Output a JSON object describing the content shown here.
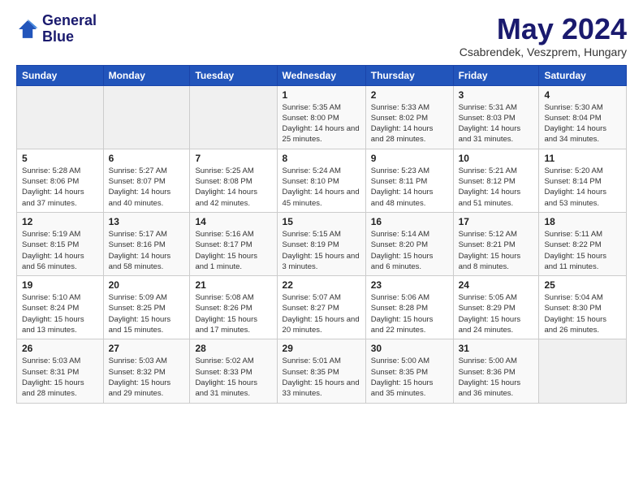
{
  "header": {
    "logo_line1": "General",
    "logo_line2": "Blue",
    "month": "May 2024",
    "location": "Csabrendek, Veszprem, Hungary"
  },
  "weekdays": [
    "Sunday",
    "Monday",
    "Tuesday",
    "Wednesday",
    "Thursday",
    "Friday",
    "Saturday"
  ],
  "weeks": [
    [
      {
        "day": "",
        "text": ""
      },
      {
        "day": "",
        "text": ""
      },
      {
        "day": "",
        "text": ""
      },
      {
        "day": "1",
        "text": "Sunrise: 5:35 AM\nSunset: 8:00 PM\nDaylight: 14 hours\nand 25 minutes."
      },
      {
        "day": "2",
        "text": "Sunrise: 5:33 AM\nSunset: 8:02 PM\nDaylight: 14 hours\nand 28 minutes."
      },
      {
        "day": "3",
        "text": "Sunrise: 5:31 AM\nSunset: 8:03 PM\nDaylight: 14 hours\nand 31 minutes."
      },
      {
        "day": "4",
        "text": "Sunrise: 5:30 AM\nSunset: 8:04 PM\nDaylight: 14 hours\nand 34 minutes."
      }
    ],
    [
      {
        "day": "5",
        "text": "Sunrise: 5:28 AM\nSunset: 8:06 PM\nDaylight: 14 hours\nand 37 minutes."
      },
      {
        "day": "6",
        "text": "Sunrise: 5:27 AM\nSunset: 8:07 PM\nDaylight: 14 hours\nand 40 minutes."
      },
      {
        "day": "7",
        "text": "Sunrise: 5:25 AM\nSunset: 8:08 PM\nDaylight: 14 hours\nand 42 minutes."
      },
      {
        "day": "8",
        "text": "Sunrise: 5:24 AM\nSunset: 8:10 PM\nDaylight: 14 hours\nand 45 minutes."
      },
      {
        "day": "9",
        "text": "Sunrise: 5:23 AM\nSunset: 8:11 PM\nDaylight: 14 hours\nand 48 minutes."
      },
      {
        "day": "10",
        "text": "Sunrise: 5:21 AM\nSunset: 8:12 PM\nDaylight: 14 hours\nand 51 minutes."
      },
      {
        "day": "11",
        "text": "Sunrise: 5:20 AM\nSunset: 8:14 PM\nDaylight: 14 hours\nand 53 minutes."
      }
    ],
    [
      {
        "day": "12",
        "text": "Sunrise: 5:19 AM\nSunset: 8:15 PM\nDaylight: 14 hours\nand 56 minutes."
      },
      {
        "day": "13",
        "text": "Sunrise: 5:17 AM\nSunset: 8:16 PM\nDaylight: 14 hours\nand 58 minutes."
      },
      {
        "day": "14",
        "text": "Sunrise: 5:16 AM\nSunset: 8:17 PM\nDaylight: 15 hours\nand 1 minute."
      },
      {
        "day": "15",
        "text": "Sunrise: 5:15 AM\nSunset: 8:19 PM\nDaylight: 15 hours\nand 3 minutes."
      },
      {
        "day": "16",
        "text": "Sunrise: 5:14 AM\nSunset: 8:20 PM\nDaylight: 15 hours\nand 6 minutes."
      },
      {
        "day": "17",
        "text": "Sunrise: 5:12 AM\nSunset: 8:21 PM\nDaylight: 15 hours\nand 8 minutes."
      },
      {
        "day": "18",
        "text": "Sunrise: 5:11 AM\nSunset: 8:22 PM\nDaylight: 15 hours\nand 11 minutes."
      }
    ],
    [
      {
        "day": "19",
        "text": "Sunrise: 5:10 AM\nSunset: 8:24 PM\nDaylight: 15 hours\nand 13 minutes."
      },
      {
        "day": "20",
        "text": "Sunrise: 5:09 AM\nSunset: 8:25 PM\nDaylight: 15 hours\nand 15 minutes."
      },
      {
        "day": "21",
        "text": "Sunrise: 5:08 AM\nSunset: 8:26 PM\nDaylight: 15 hours\nand 17 minutes."
      },
      {
        "day": "22",
        "text": "Sunrise: 5:07 AM\nSunset: 8:27 PM\nDaylight: 15 hours\nand 20 minutes."
      },
      {
        "day": "23",
        "text": "Sunrise: 5:06 AM\nSunset: 8:28 PM\nDaylight: 15 hours\nand 22 minutes."
      },
      {
        "day": "24",
        "text": "Sunrise: 5:05 AM\nSunset: 8:29 PM\nDaylight: 15 hours\nand 24 minutes."
      },
      {
        "day": "25",
        "text": "Sunrise: 5:04 AM\nSunset: 8:30 PM\nDaylight: 15 hours\nand 26 minutes."
      }
    ],
    [
      {
        "day": "26",
        "text": "Sunrise: 5:03 AM\nSunset: 8:31 PM\nDaylight: 15 hours\nand 28 minutes."
      },
      {
        "day": "27",
        "text": "Sunrise: 5:03 AM\nSunset: 8:32 PM\nDaylight: 15 hours\nand 29 minutes."
      },
      {
        "day": "28",
        "text": "Sunrise: 5:02 AM\nSunset: 8:33 PM\nDaylight: 15 hours\nand 31 minutes."
      },
      {
        "day": "29",
        "text": "Sunrise: 5:01 AM\nSunset: 8:35 PM\nDaylight: 15 hours\nand 33 minutes."
      },
      {
        "day": "30",
        "text": "Sunrise: 5:00 AM\nSunset: 8:35 PM\nDaylight: 15 hours\nand 35 minutes."
      },
      {
        "day": "31",
        "text": "Sunrise: 5:00 AM\nSunset: 8:36 PM\nDaylight: 15 hours\nand 36 minutes."
      },
      {
        "day": "",
        "text": ""
      }
    ]
  ]
}
